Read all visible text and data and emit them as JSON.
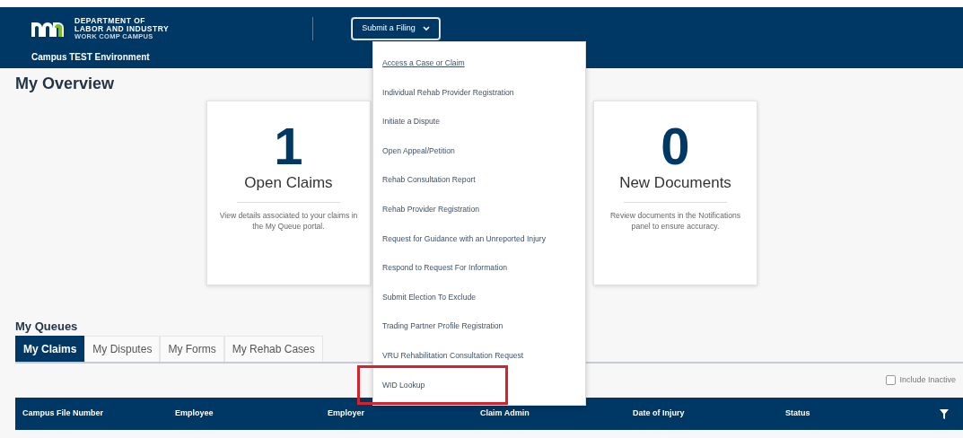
{
  "header": {
    "logo_lines": [
      "DEPARTMENT OF",
      "LABOR AND INDUSTRY",
      "WORK COMP CAMPUS"
    ],
    "environment": "Campus TEST Environment",
    "menu_button": {
      "label": "Submit a Filing",
      "expanded": true
    }
  },
  "dropdown": [
    {
      "label": "Access a Case or Claim",
      "focused": true,
      "highlighted": false
    },
    {
      "label": "Individual Rehab Provider Registration",
      "focused": false,
      "highlighted": false
    },
    {
      "label": "Initiate a Dispute",
      "focused": false,
      "highlighted": false
    },
    {
      "label": "Open Appeal/Petition",
      "focused": false,
      "highlighted": false
    },
    {
      "label": "Rehab Consultation Report",
      "focused": false,
      "highlighted": false
    },
    {
      "label": "Rehab Provider Registration",
      "focused": false,
      "highlighted": false
    },
    {
      "label": "Request for Guidance with an Unreported Injury",
      "focused": false,
      "highlighted": false
    },
    {
      "label": "Respond to Request For Information",
      "focused": false,
      "highlighted": false
    },
    {
      "label": "Submit Election To Exclude",
      "focused": false,
      "highlighted": false
    },
    {
      "label": "Trading Partner Profile Registration",
      "focused": false,
      "highlighted": false
    },
    {
      "label": "VRU Rehabilitation Consultation Request",
      "focused": false,
      "highlighted": false
    },
    {
      "label": "WID Lookup",
      "focused": false,
      "highlighted": true
    }
  ],
  "overview": {
    "title": "My Overview",
    "cards": [
      {
        "count": "1",
        "label": "Open Claims",
        "description": "View details associated to your claims in the My Queue portal."
      },
      {
        "count": "0",
        "label": "New Documents",
        "description": "Review documents in the Notifications panel to ensure accuracy."
      }
    ]
  },
  "queues": {
    "title": "My Queues",
    "tabs": [
      {
        "label": "My Claims",
        "selected": true
      },
      {
        "label": "My Disputes",
        "selected": false
      },
      {
        "label": "My Forms",
        "selected": false
      },
      {
        "label": "My Rehab Cases",
        "selected": false
      }
    ],
    "include_inactive": {
      "label": "Include Inactive",
      "checked": false
    },
    "table": {
      "columns": [
        "Campus File Number",
        "Employee",
        "Employer",
        "Claim Admin",
        "Date of Injury",
        "Status"
      ]
    }
  }
}
